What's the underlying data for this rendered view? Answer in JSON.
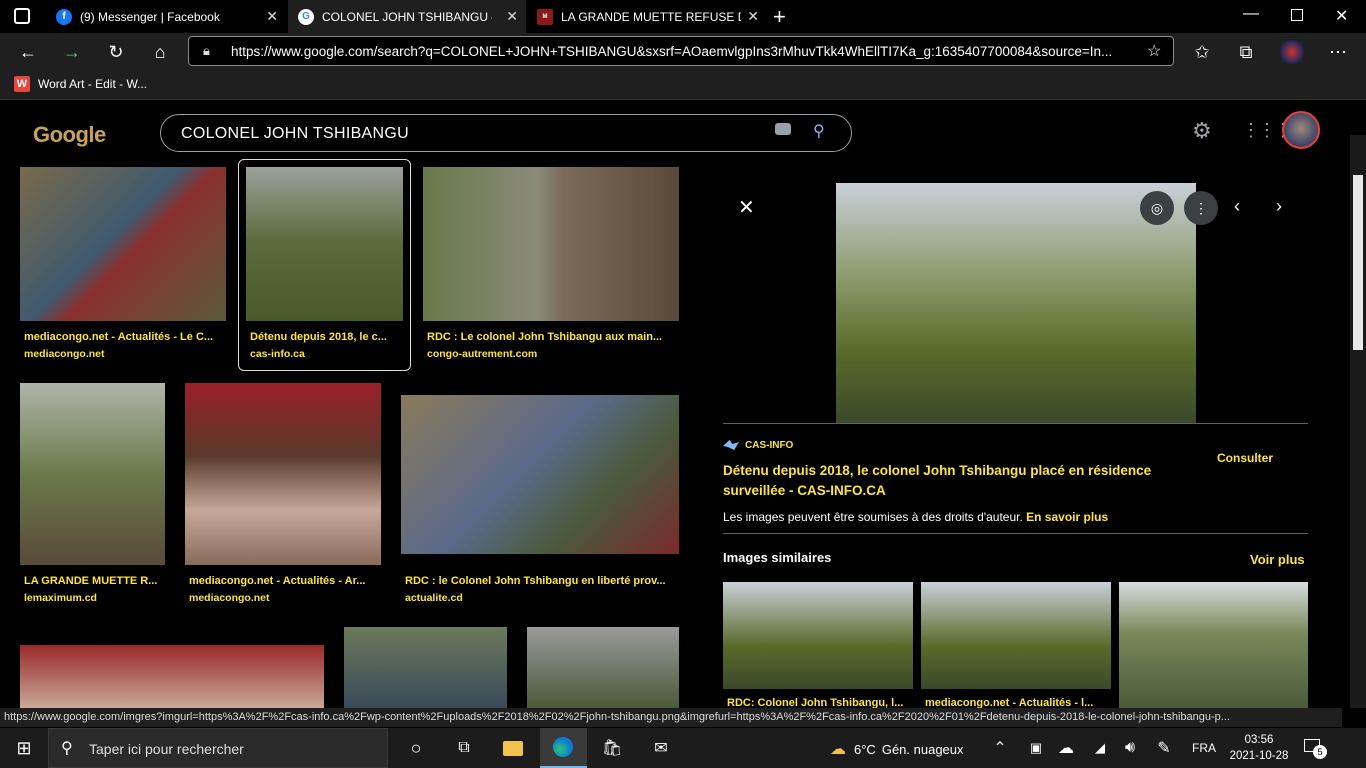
{
  "browser": {
    "tabs": [
      {
        "label": "(9) Messenger | Facebook",
        "icon": "facebook-icon"
      },
      {
        "label": "COLONEL JOHN TSHIBANGU – R",
        "icon": "google-icon"
      },
      {
        "label": "LA GRANDE MUETTE REFUSE D'E",
        "icon": "site-icon"
      }
    ],
    "url": "https://www.google.com/search?q=COLONEL+JOHN+TSHIBANGU&sxsrf=AOaemvlgpIns3rMhuvTkk4WhEllTI7Ka_g:1635407700084&source=In...",
    "bookmark": "Word Art - Edit - W..."
  },
  "google": {
    "logo": "Google",
    "query": "COLONEL JOHN TSHIBANGU"
  },
  "results": [
    {
      "caption": "mediacongo.net - Actualités - Le C...",
      "source": "mediacongo.net"
    },
    {
      "caption": "Détenu depuis 2018, le c...",
      "source": "cas-info.ca"
    },
    {
      "caption": "RDC : Le colonel John Tshibangu aux main...",
      "source": "congo-autrement.com"
    },
    {
      "caption": "LA GRANDE MUETTE R...",
      "source": "lemaximum.cd"
    },
    {
      "caption": "mediacongo.net - Actualités - Ar...",
      "source": "mediacongo.net"
    },
    {
      "caption": "RDC : le Colonel John Tshibangu en liberté prov...",
      "source": "actualite.cd"
    }
  ],
  "panel": {
    "source_name": "CAS-INFO",
    "title": "Détenu depuis 2018, le colonel John Tshibangu placé en résidence surveillée - CAS-INFO.CA",
    "visit": "Consulter",
    "copyright": "Les images peuvent être soumises à des droits d'auteur.",
    "learn_more": "En savoir plus",
    "similar_heading": "Images similaires",
    "see_more": "Voir plus",
    "similar_captions": [
      "RDC: Colonel John Tshibangu, l...",
      "mediacongo.net - Actualités - l..."
    ]
  },
  "status_url": "https://www.google.com/imgres?imgurl=https%3A%2F%2Fcas-info.ca%2Fwp-content%2Fuploads%2F2018%2F02%2Fjohn-tshibangu.png&imgrefurl=https%3A%2F%2Fcas-info.ca%2F2020%2F01%2Fdetenu-depuis-2018-le-colonel-john-tshibangu-p...",
  "taskbar": {
    "search_placeholder": "Taper ici pour rechercher",
    "weather_temp": "6°C",
    "weather_desc": "Gén. nuageux",
    "lang": "FRA",
    "time": "03:56",
    "date": "2021-10-28",
    "notif_count": "5"
  },
  "colors": {
    "accent": "#fde53b",
    "link_blue": "#8ab4f8"
  }
}
